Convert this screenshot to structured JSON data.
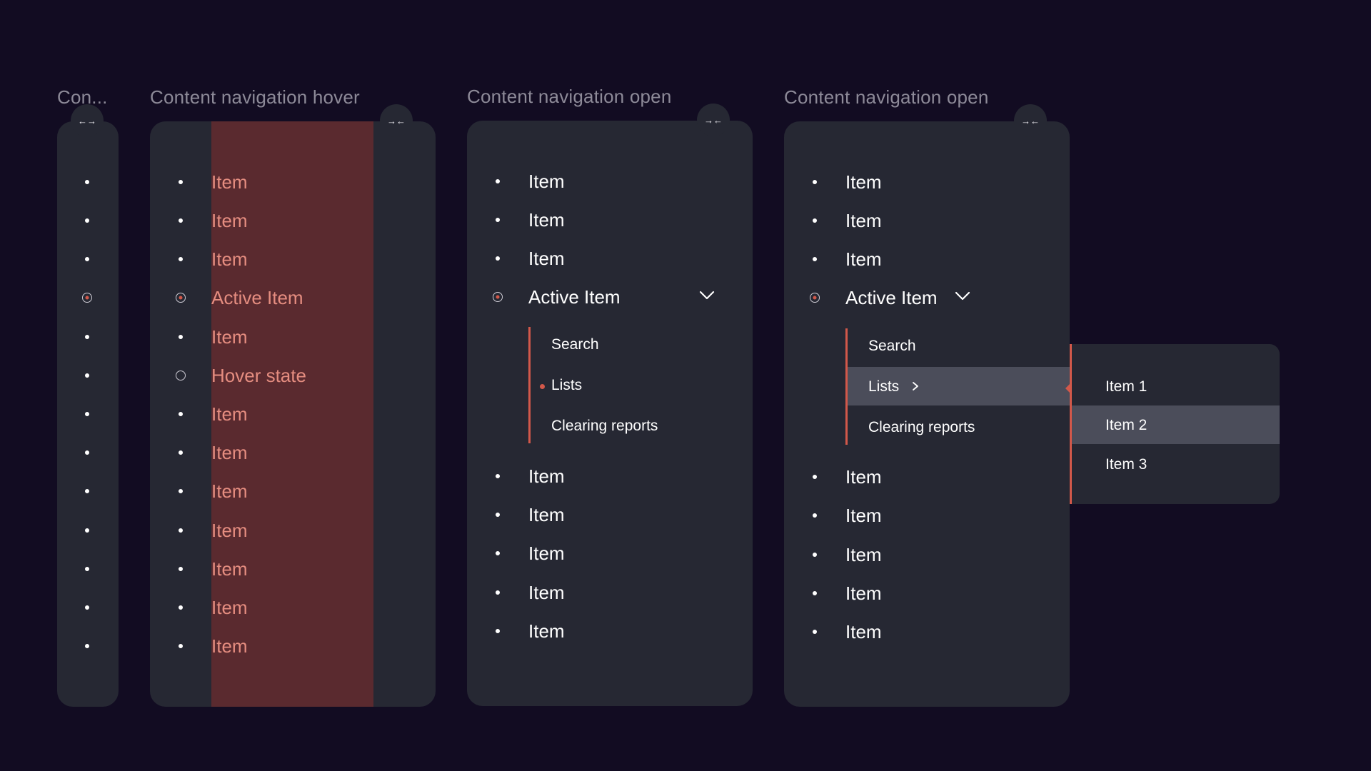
{
  "panels": {
    "collapsed": {
      "title": "Con...",
      "toggle_icon": "←→"
    },
    "hover": {
      "title": "Content navigation hover",
      "toggle_icon": "→←",
      "items": [
        "Item",
        "Item",
        "Item",
        "Active Item",
        "Item",
        "Hover state",
        "Item",
        "Item",
        "Item",
        "Item",
        "Item",
        "Item",
        "Item"
      ]
    },
    "open": {
      "title": "Content navigation open",
      "toggle_icon": "→←",
      "items_top": [
        "Item",
        "Item",
        "Item"
      ],
      "active_item": "Active Item",
      "subitems": [
        "Search",
        "Lists",
        "Clearing reports"
      ],
      "items_bottom": [
        "Item",
        "Item",
        "Item",
        "Item",
        "Item"
      ]
    },
    "open_flyout": {
      "title": "Content navigation open",
      "toggle_icon": "→←",
      "items_top": [
        "Item",
        "Item",
        "Item"
      ],
      "active_item": "Active Item",
      "subitems": [
        "Search",
        "Lists",
        "Clearing reports"
      ],
      "items_bottom": [
        "Item",
        "Item",
        "Item",
        "Item",
        "Item"
      ],
      "flyout_items": [
        "Item 1",
        "Item 2",
        "Item 3"
      ]
    }
  },
  "colors": {
    "background": "#120c22",
    "panel": "#262833",
    "accent": "#d2584a",
    "hover_fill": "#5a2a2f",
    "hover_text": "#e58d80",
    "selected_row": "#4b4d5a"
  }
}
